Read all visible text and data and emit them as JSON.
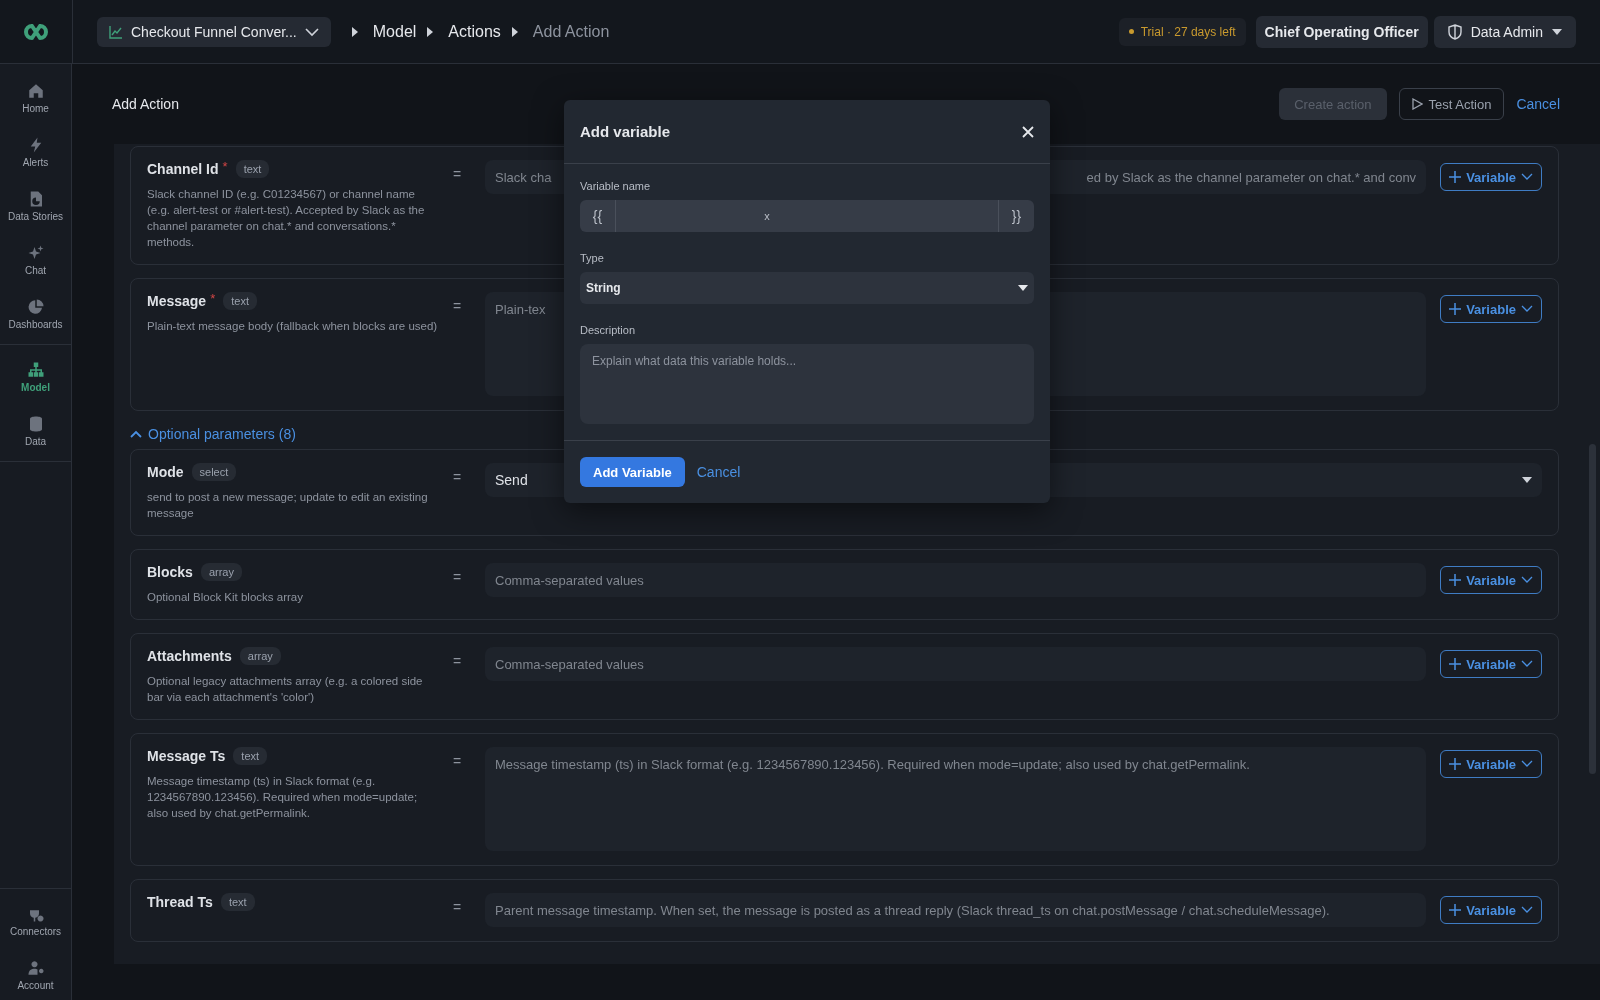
{
  "topbar": {
    "source": "Checkout Funnel Conver...",
    "crumbs": [
      {
        "label": "Model",
        "current": false
      },
      {
        "label": "Actions",
        "current": false
      },
      {
        "label": "Add Action",
        "current": true
      }
    ],
    "trial": "Trial · 27 days left",
    "role": "Chief Operating Officer",
    "user": "Data Admin"
  },
  "sidebar": {
    "groups": [
      [
        {
          "label": "Home",
          "selected": false
        },
        {
          "label": "Alerts",
          "selected": false
        },
        {
          "label": "Data Stories",
          "selected": false
        },
        {
          "label": "Chat",
          "selected": false
        },
        {
          "label": "Dashboards",
          "selected": false
        }
      ],
      [
        {
          "label": "Model",
          "selected": true
        },
        {
          "label": "Data",
          "selected": false
        }
      ]
    ],
    "bottom_items": [
      {
        "label": "Connectors",
        "selected": false
      },
      {
        "label": "Account",
        "selected": false
      }
    ]
  },
  "page": {
    "title": "Add Action",
    "create_button": {
      "label": "Create action",
      "disabled": true
    },
    "test_button": "Test Action",
    "cancel": "Cancel"
  },
  "required_params": [
    {
      "name": "Channel Id",
      "required_mark": "*",
      "type": "text",
      "equals": "=",
      "description": "Slack channel ID (e.g. C01234567) or channel name (e.g. alert-test or #alert-test). Accepted by Slack as the channel parameter on chat.* and conversations.* methods.",
      "field": {
        "kind": "input",
        "placeholder_parts": [
          "Slack cha",
          "ed by Slack as the channel parameter on chat.* and conv"
        ]
      },
      "variable_button": "Variable"
    },
    {
      "name": "Message",
      "required_mark": "*",
      "type": "text",
      "equals": "=",
      "description": "Plain-text message body (fallback when blocks are used)",
      "field": {
        "kind": "textarea",
        "placeholder_parts": [
          "Plain-tex"
        ]
      },
      "variable_button": "Variable"
    }
  ],
  "optional_toggle": {
    "label": "Optional parameters (8)",
    "expanded": true
  },
  "optional_params": [
    {
      "name": "Mode",
      "type": "select",
      "equals": "=",
      "description": "send to post a new message; update to edit an existing message",
      "field": {
        "kind": "select",
        "value": "Send"
      }
    },
    {
      "name": "Blocks",
      "type": "array",
      "equals": "=",
      "description": "Optional Block Kit blocks array",
      "field": {
        "kind": "input",
        "placeholder_parts": [
          "Comma-separated values"
        ]
      },
      "variable_button": "Variable"
    },
    {
      "name": "Attachments",
      "type": "array",
      "equals": "=",
      "description": "Optional legacy attachments array (e.g. a colored side bar via each attachment's 'color')",
      "field": {
        "kind": "input",
        "placeholder_parts": [
          "Comma-separated values"
        ]
      },
      "variable_button": "Variable"
    },
    {
      "name": "Message Ts",
      "type": "text",
      "equals": "=",
      "description": "Message timestamp (ts) in Slack format (e.g. 1234567890.123456). Required when mode=update; also used by chat.getPermalink.",
      "field": {
        "kind": "textarea",
        "placeholder_parts": [
          "Message timestamp (ts) in Slack format (e.g. 1234567890.123456). Required when mode=update; also used by chat.getPermalink."
        ]
      },
      "variable_button": "Variable"
    },
    {
      "name": "Thread Ts",
      "type": "text",
      "equals": "=",
      "field": {
        "kind": "input",
        "placeholder_parts": [
          "Parent message timestamp. When set, the message is posted as a thread reply (Slack thread_ts on chat.postMessage / chat.scheduleMessage)."
        ]
      },
      "variable_button": "Variable"
    }
  ],
  "dialog": {
    "title": "Add variable",
    "name_label": "Variable name",
    "prefix": "{{",
    "name_value": "x",
    "suffix": "}}",
    "type_label": "Type",
    "type_value": "String",
    "description_label": "Description",
    "description_placeholder": "Explain what data this variable holds...",
    "submit": "Add Variable",
    "cancel": "Cancel"
  }
}
